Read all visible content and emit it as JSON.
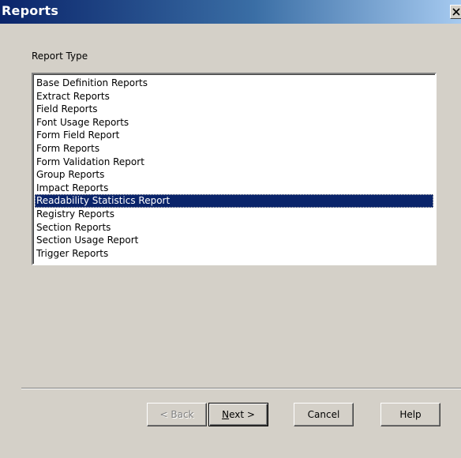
{
  "window": {
    "title": "Reports",
    "close_glyph": "✕"
  },
  "form": {
    "report_type_label": "Report Type"
  },
  "list": {
    "items": [
      "Base Definition Reports",
      "Extract Reports",
      "Field Reports",
      "Font Usage Reports",
      "Form Field Report",
      "Form Reports",
      "Form Validation Report",
      "Group Reports",
      "Impact Reports",
      "Readability Statistics Report",
      "Registry Reports",
      "Section Reports",
      "Section Usage Report",
      "Trigger Reports"
    ],
    "selected_index": 9
  },
  "buttons": {
    "back": {
      "label": "< Back",
      "enabled": false
    },
    "next": {
      "label": "Next >",
      "enabled": true
    },
    "cancel": {
      "label": "Cancel",
      "enabled": true
    },
    "help": {
      "label": "Help",
      "enabled": true
    }
  },
  "colors": {
    "title_bar_start": "#0a246a",
    "title_bar_end": "#a6caf0",
    "selection": "#0a246a",
    "dialog_face": "#d4d0c8"
  }
}
